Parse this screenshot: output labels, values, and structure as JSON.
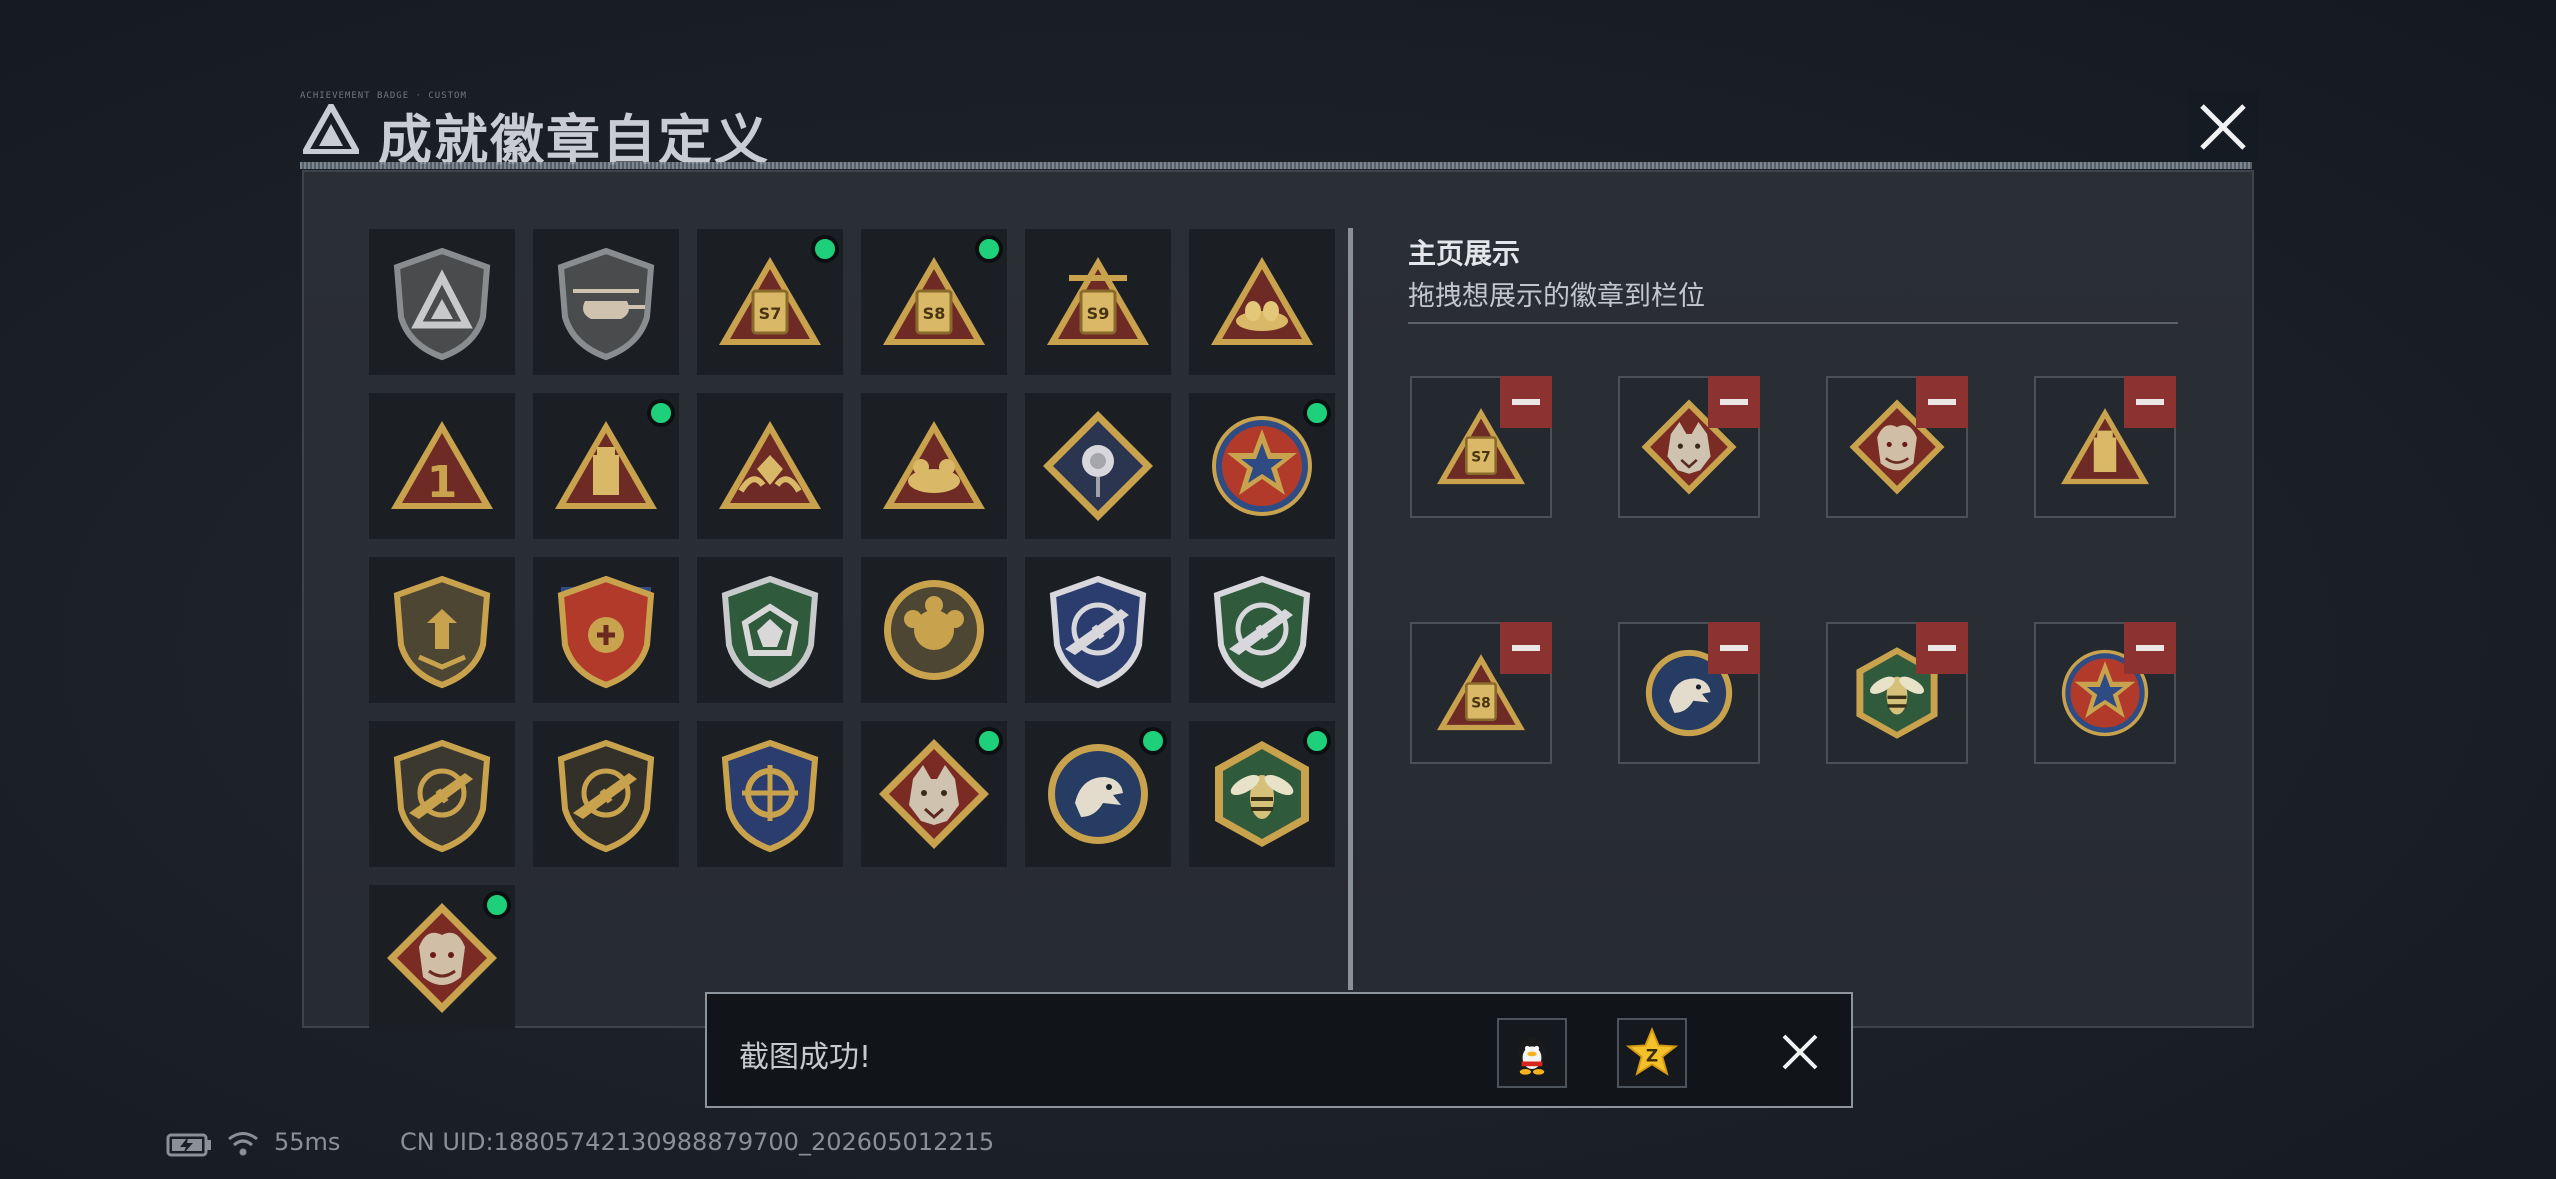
{
  "title": {
    "text": "成就徽章自定义",
    "deco_text": "ACHIEVEMENT BADGE · CUSTOM"
  },
  "showcase": {
    "title": "主页展示",
    "subtitle": "拖拽想展示的徽章到栏位"
  },
  "badges": [
    {
      "name": "base-badge",
      "new": false
    },
    {
      "name": "helicopter-badge",
      "new": false
    },
    {
      "name": "season-s7-badge",
      "new": true,
      "label": "S7"
    },
    {
      "name": "season-s8-badge",
      "new": true,
      "label": "S8"
    },
    {
      "name": "season-s9-badge",
      "new": false,
      "label": "S9"
    },
    {
      "name": "bird-nest-badge",
      "new": false
    },
    {
      "name": "rank-one-badge",
      "new": false,
      "label": "1"
    },
    {
      "name": "tower-badge",
      "new": true
    },
    {
      "name": "hands-gem-badge",
      "new": false
    },
    {
      "name": "animals-badge",
      "new": false
    },
    {
      "name": "rose-badge",
      "new": false
    },
    {
      "name": "star-crest-badge",
      "new": true
    },
    {
      "name": "winged-shield-badge",
      "new": false
    },
    {
      "name": "ribbon-shield-badge",
      "new": false
    },
    {
      "name": "green-gem-shield-badge",
      "new": false
    },
    {
      "name": "fist-emblem-badge",
      "new": false
    },
    {
      "name": "blue-rifle-shield-badge",
      "new": false
    },
    {
      "name": "green-rifle-shield-badge",
      "new": false
    },
    {
      "name": "rifle-shield-badge",
      "new": false
    },
    {
      "name": "rifle-shield-dark-badge",
      "new": false
    },
    {
      "name": "gold-crosshair-shield-badge",
      "new": false
    },
    {
      "name": "wolf-badge",
      "new": true
    },
    {
      "name": "eagle-badge",
      "new": true
    },
    {
      "name": "hornet-badge",
      "new": true
    },
    {
      "name": "dragon-badge",
      "new": true
    }
  ],
  "slots": [
    {
      "name": "slot-season-s7",
      "label": "S7"
    },
    {
      "name": "slot-wolf"
    },
    {
      "name": "slot-dragon"
    },
    {
      "name": "slot-tower"
    },
    {
      "name": "slot-season-s8",
      "label": "S8"
    },
    {
      "name": "slot-eagle"
    },
    {
      "name": "slot-hornet"
    },
    {
      "name": "slot-star-crest"
    }
  ],
  "toast": {
    "text": "截图成功!",
    "share_qq": "qq-icon",
    "share_qzone": "qzone-icon"
  },
  "status": {
    "battery_icon": "battery-charging-icon",
    "wifi_icon": "wifi-icon",
    "ping": "55ms",
    "uid": "CN UID:18805742130988879700_202605012215"
  },
  "colors": {
    "new_dot": "#1fd07a",
    "remove": "#8c3331",
    "gold": "#c9a24d",
    "red_tri": "#6e2a25"
  }
}
